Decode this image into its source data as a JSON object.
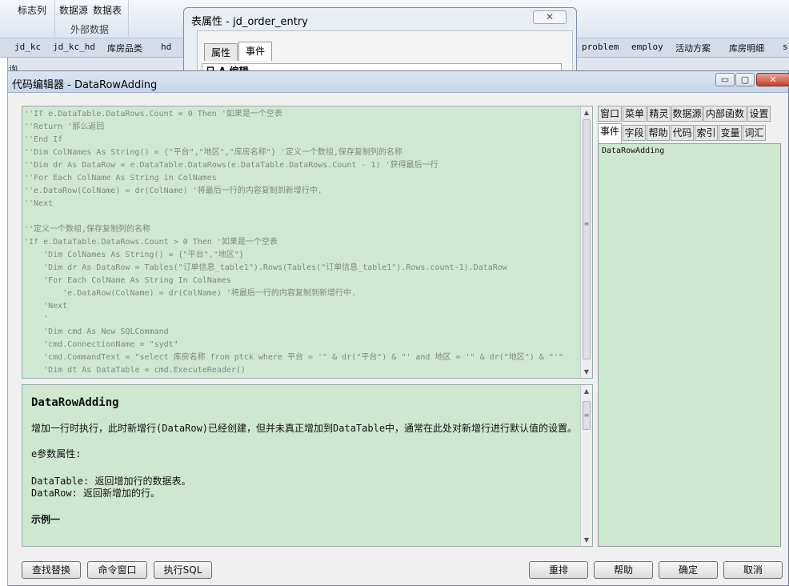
{
  "ribbon": {
    "items": [
      "标志列",
      "数据源",
      "数据表"
    ],
    "group_label": "外部数据"
  },
  "tables": [
    "jd_kc",
    "jd_kc_hd",
    "库房品类",
    "hd",
    "problem",
    "employ",
    "活动方案",
    "库房明细",
    "s"
  ],
  "left_fragment": "查询",
  "property_dialog": {
    "title": "表属性 - jd_order_entry",
    "tabs": [
      "属性",
      "事件"
    ],
    "section": "日 A 编辑"
  },
  "editor": {
    "title": "代码编辑器 - DataRowAdding",
    "code_lines": [
      "''If e.DataTable.DataRows.Count = 0 Then '如果是一个空表",
      "''Return '那么返回",
      "''End If",
      "''Dim ColNames As String() = {\"平台\",\"地区\",\"库房名称\"} '定义一个数组,保存复制列的名称",
      "''Dim dr As DataRow = e.DataTable.DataRows(e.DataTable.DataRows.Count - 1) '获得最后一行",
      "''For Each ColName As String in ColNames",
      "''e.DataRow(ColName) = dr(ColName) '将最后一行的内容复制到新增行中.",
      "''Next",
      "",
      "''定义一个数组,保存复制列的名称",
      "'If e.DataTable.DataRows.Count > 0 Then '如果是一个空表",
      "    'Dim ColNames As String() = {\"平台\",\"地区\"}",
      "    'Dim dr As DataRow = Tables(\"订单信息_table1\").Rows(Tables(\"订单信息_table1\").Rows.count-1).DataRow",
      "    'For Each ColName As String In ColNames",
      "        'e.DataRow(ColName) = dr(ColName) '将最后一行的内容复制到新增行中.",
      "    'Next",
      "    '",
      "    'Dim cmd As New SQLCommand",
      "    'cmd.ConnectionName = \"sydt\"",
      "    'cmd.CommandText = \"select 库房名称 from ptck where 平台 = '\" & dr(\"平台\") & \"' and 地区 = '\" & dr(\"地区\") & \"'\"",
      "    'Dim dt As DataTable = cmd.ExecuteReader()"
    ],
    "help": {
      "title": "DataRowAdding",
      "description": "增加一行时执行，此时新增行(DataRow)已经创建，但并未真正增加到DataTable中，通常在此处对新增行进行默认值的设置。",
      "params_heading": "e参数属性:",
      "params": [
        "DataTable: 返回增加行的数据表。",
        "DataRow:   返回新增加的行。"
      ],
      "example_heading": "示例一"
    },
    "right_tabs_row1": [
      "窗口",
      "菜单",
      "精灵",
      "数据源",
      "内部函数",
      "设置"
    ],
    "right_tabs_row2": [
      "事件",
      "字段",
      "帮助",
      "代码",
      "索引",
      "变量",
      "词汇"
    ],
    "event_list": [
      "DataRowAdding"
    ],
    "buttons_left": [
      "查找替换",
      "命令窗口",
      "执行SQL"
    ],
    "buttons_right": [
      "重排",
      "帮助",
      "确定",
      "取消"
    ],
    "window_buttons": [
      "▭",
      "▢",
      "✕"
    ]
  },
  "scroll": {
    "code_thumb": "≡",
    "help_thumb": "≡"
  }
}
